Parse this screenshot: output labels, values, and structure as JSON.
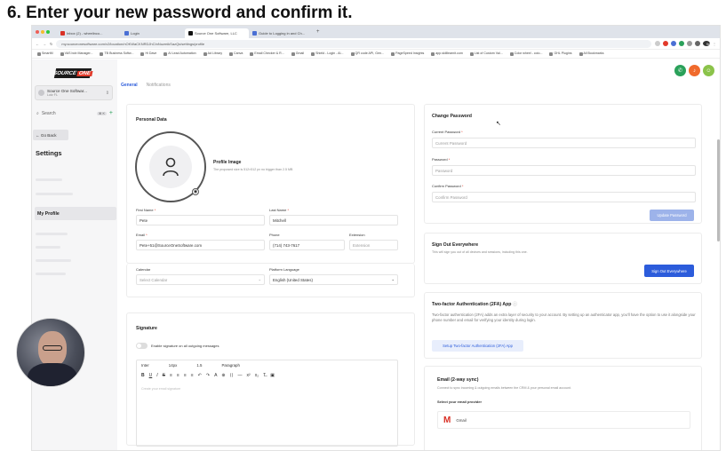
{
  "step_title": "6.  Enter your new password and confirm it.",
  "browser": {
    "tabs": [
      "Inbox (2) - wheelinco...",
      "Login",
      "Source One Software, LLC",
      "Guide to Logging in and Ch..."
    ],
    "url": "my.sourceonesoftware.com/v2/location/nOKWaCKNRDJhCInNuzmikSazQs/settings/profile",
    "profile_label": "Work",
    "bookmarks": [
      "SmartM",
      "VAS bob Manager...",
      "TB Business Softw...",
      "Hi Dave",
      "AI Lead Automation",
      "Ad Library",
      "Canva",
      "Email Checker & R...",
      "Gmail",
      "Shield - Login - AI...",
      "QR code API, Gen...",
      "PageSpeed Insights",
      "app.skilllearnit.com",
      "List of Custom Val...",
      "Color wheel - colo...",
      "GHL Plugins",
      "All Bookmarks"
    ]
  },
  "sidebar": {
    "logo_a": "SOURCE",
    "logo_b": "ONE",
    "account_name": "Source One Softwar...",
    "account_sub": "Lutz FL",
    "search_placeholder": "Search",
    "search_kbd": "⌘ K",
    "go_back": "← Go Back",
    "settings": "Settings",
    "my_profile": "My Profile"
  },
  "subtabs": [
    "General",
    "Notifications"
  ],
  "personal": {
    "title": "Personal Data",
    "profile_image_label": "Profile Image",
    "profile_image_hint": "The proposed size is 512×512 px no bigger than 2.5 MB",
    "first_name_label": "First Name",
    "first_name": "Pete",
    "last_name_label": "Last Name",
    "last_name": "Mitchell",
    "email_label": "Email",
    "email": "Pete+51@SourceOneSoftware.com",
    "phone_label": "Phone",
    "phone": "(714) 743-7617",
    "extension_label": "Extension",
    "extension_placeholder": "Extension",
    "calendar_label": "Calendar",
    "calendar_placeholder": "Select Calendar",
    "language_label": "Platform Language",
    "language": "English (United States)"
  },
  "signature": {
    "title": "Signature",
    "toggle_label": "Enable signature on all outgoing messages",
    "font": "Inter",
    "size": "14px",
    "line_height": "1.5",
    "paragraph": "Paragraph",
    "placeholder": "Create your email signature"
  },
  "change_password": {
    "title": "Change Password",
    "current_label": "Current Password",
    "current_placeholder": "Current Password",
    "new_label": "Password",
    "new_placeholder": "Password",
    "confirm_label": "Confirm Password",
    "confirm_placeholder": "Confirm Password",
    "button": "Update Password"
  },
  "sign_out": {
    "title": "Sign Out Everywhere",
    "desc": "This will sign you out of all devices and sessions, including this one.",
    "button": "Sign Out Everywhere"
  },
  "twofa": {
    "title": "Two-factor Authentication (2FA) App",
    "desc": "Two-factor authentication (2FA) adds an extra layer of security to your account. By setting up an authenticator app, you'll have the option to use it alongside your phone number and email for verifying your identity during login.",
    "button": "Setup Two-factor Authentication (2FA) App"
  },
  "email_sync": {
    "title": "Email (2-way sync)",
    "desc": "Connect to sync incoming & outgoing emails between the CRM & your personal email account.",
    "provider_label": "Select your email provider",
    "gmail": "Gmail"
  },
  "colors": {
    "accent": "#2c5cdb",
    "disabled_button": "#9db3ea",
    "logo_red": "#e23a2a"
  }
}
